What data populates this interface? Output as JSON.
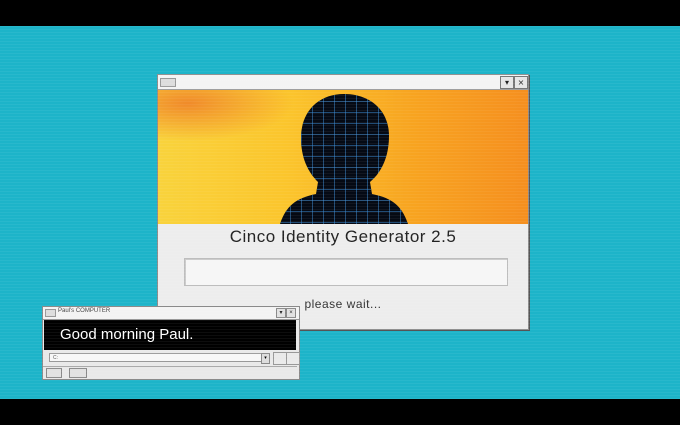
{
  "dialog": {
    "title": "",
    "scroll_down_glyph": "▾",
    "close_glyph": "×",
    "app_title": "Cinco Identity Generator 2.5",
    "progress": 0,
    "status": "please wait..."
  },
  "terminal": {
    "title": "Paul's COMPUTER",
    "greeting": "Good morning Paul.",
    "command_value": "C:",
    "dropdown_glyph": "▾",
    "minimize_glyph": "▾",
    "close_glyph": "×"
  },
  "colors": {
    "desktop": "#1db4c9",
    "banner_yellow": "#f9d33c",
    "banner_orange": "#f58f1f",
    "silhouette_grid": "#3d8fd8"
  },
  "icons": [
    "window-menu-icon",
    "scroll-down-icon",
    "close-icon",
    "head-grid-silhouette-icon"
  ]
}
